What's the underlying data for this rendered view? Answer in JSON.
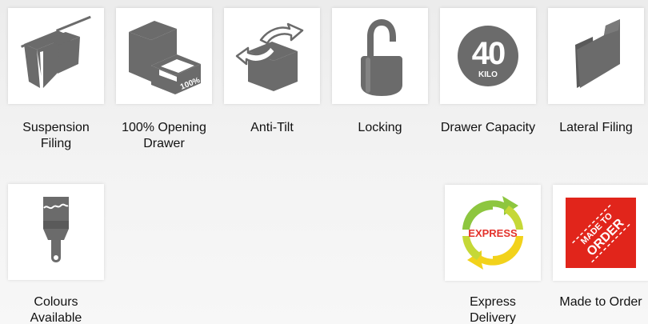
{
  "features": [
    {
      "label": "Suspension Filing",
      "icon": "suspension-filing-icon"
    },
    {
      "label": "100% Opening Drawer",
      "icon": "opening-drawer-icon",
      "icon_text": "100%"
    },
    {
      "label": "Anti-Tilt",
      "icon": "anti-tilt-icon"
    },
    {
      "label": "Locking",
      "icon": "padlock-icon"
    },
    {
      "label": "Drawer Capacity",
      "icon": "capacity-badge-icon",
      "icon_number": "40",
      "icon_unit": "KILO"
    },
    {
      "label": "Lateral Filing",
      "icon": "lateral-folder-icon"
    },
    {
      "label": "Colours Available",
      "icon": "paintbrush-icon"
    },
    {
      "label": "Express Delivery",
      "icon": "express-cycle-icon",
      "icon_text": "EXPRESS"
    },
    {
      "label": "Made to Order",
      "icon": "made-to-order-stamp-icon",
      "icon_text_top": "MADE TO",
      "icon_text_bottom": "ORDER"
    }
  ],
  "colors": {
    "icon_gray": "#6b6b6b",
    "icon_dark": "#555555",
    "express_green": "#8dc63f",
    "express_yellow": "#f2d21b",
    "express_red": "#e3322b",
    "order_red": "#e1251b"
  }
}
